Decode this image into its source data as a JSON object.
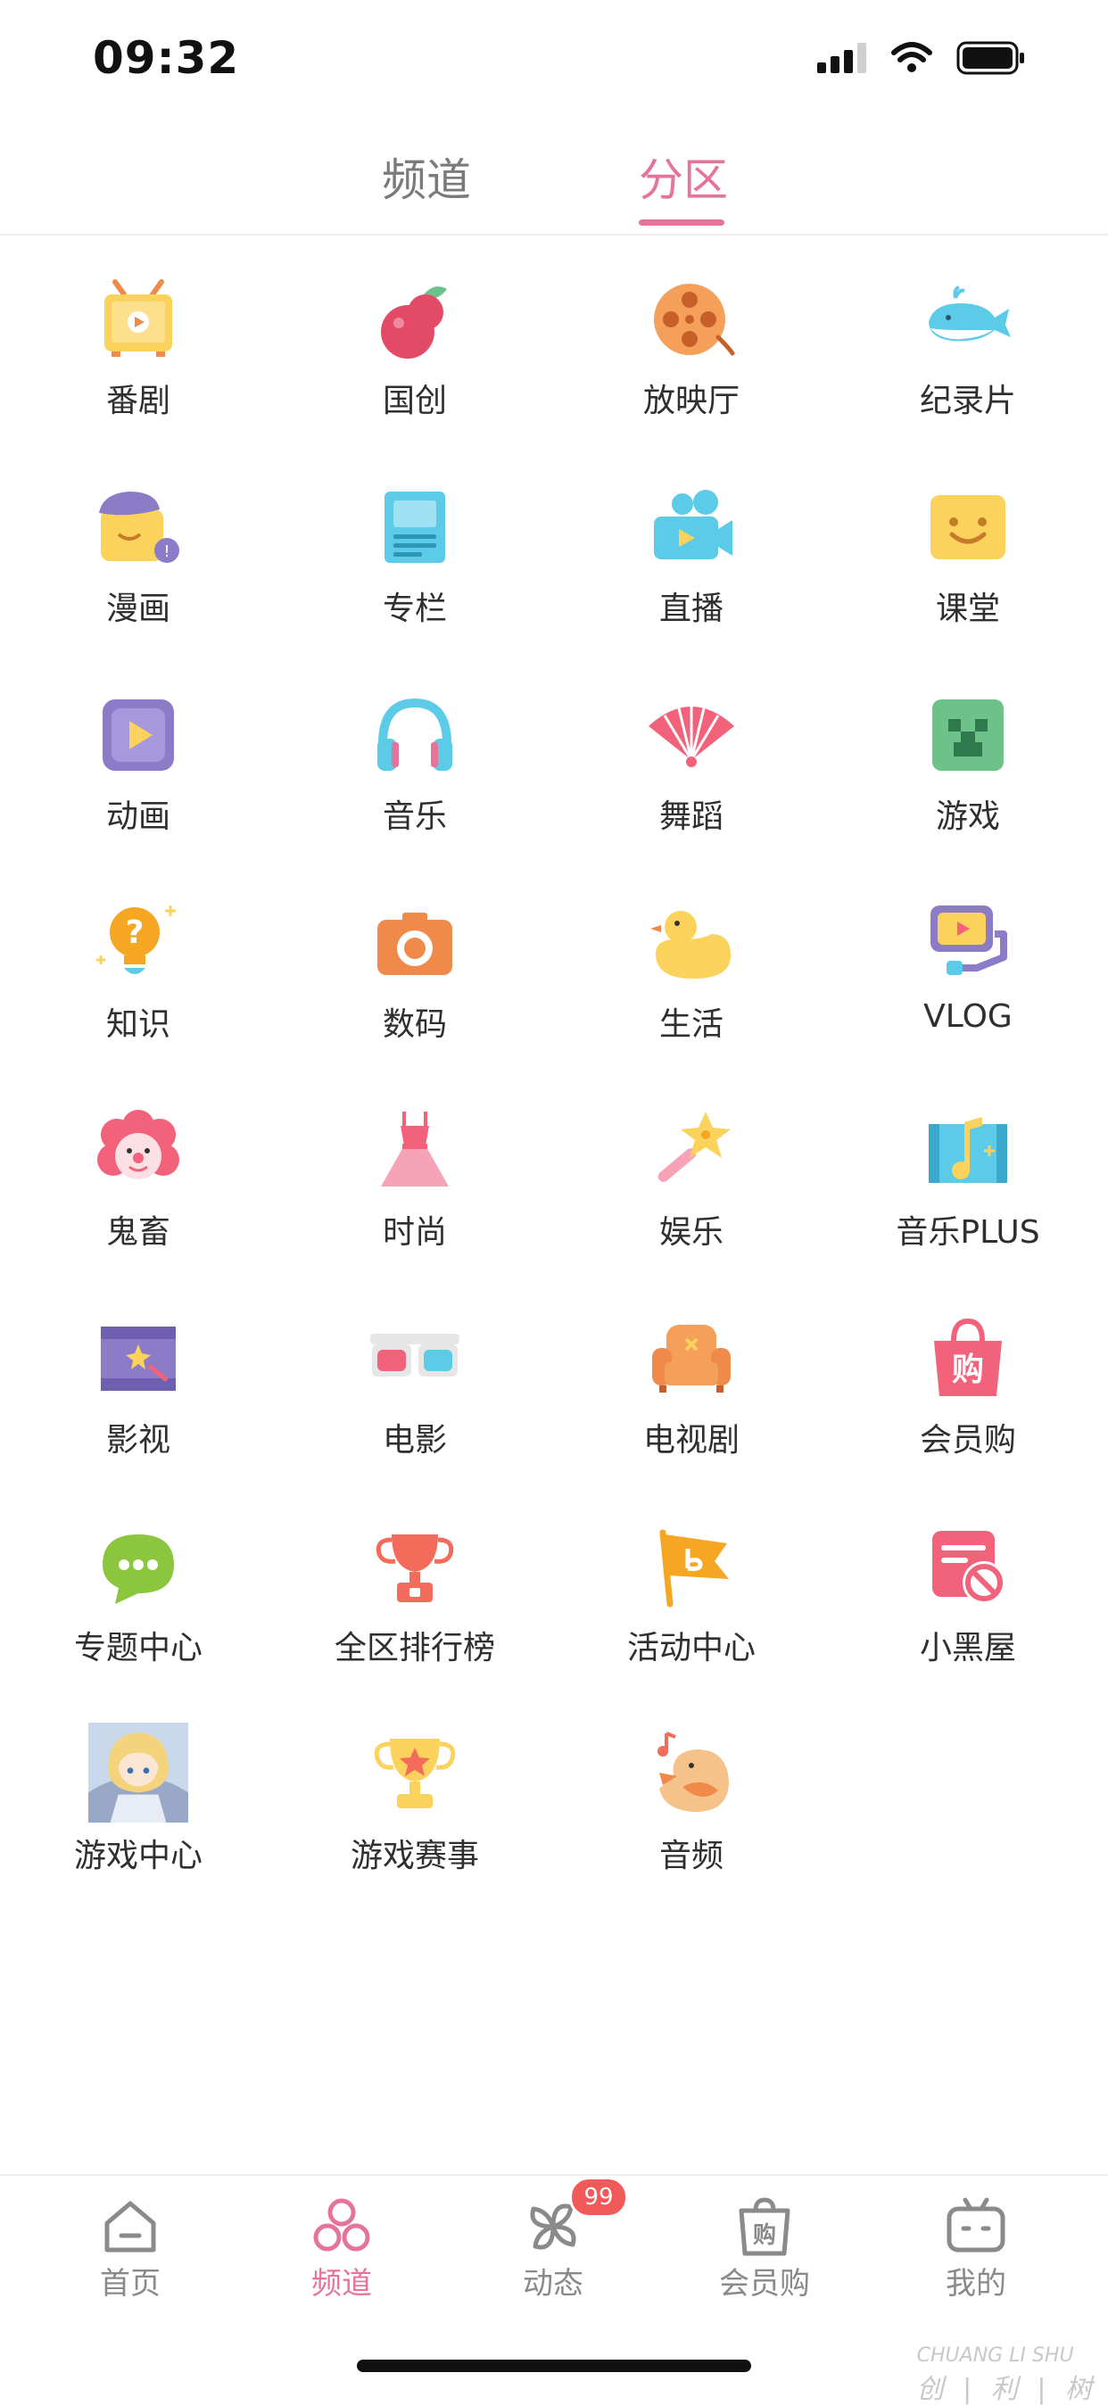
{
  "status_bar": {
    "time": "09:32"
  },
  "top_tabs": {
    "channel": "频道",
    "zone": "分区"
  },
  "grid": [
    [
      {
        "label": "番剧",
        "icon": "tv-icon"
      },
      {
        "label": "国创",
        "icon": "fruit-icon"
      },
      {
        "label": "放映厅",
        "icon": "film-reel-icon"
      },
      {
        "label": "纪录片",
        "icon": "whale-icon"
      }
    ],
    [
      {
        "label": "漫画",
        "icon": "comic-icon"
      },
      {
        "label": "专栏",
        "icon": "article-icon"
      },
      {
        "label": "直播",
        "icon": "camera-icon"
      },
      {
        "label": "课堂",
        "icon": "classroom-icon"
      }
    ],
    [
      {
        "label": "动画",
        "icon": "animation-icon"
      },
      {
        "label": "音乐",
        "icon": "headphones-icon"
      },
      {
        "label": "舞蹈",
        "icon": "fan-icon"
      },
      {
        "label": "游戏",
        "icon": "game-icon"
      }
    ],
    [
      {
        "label": "知识",
        "icon": "lightbulb-icon"
      },
      {
        "label": "数码",
        "icon": "photo-camera-icon"
      },
      {
        "label": "生活",
        "icon": "duck-icon"
      },
      {
        "label": "VLOG",
        "icon": "vlog-icon"
      }
    ],
    [
      {
        "label": "鬼畜",
        "icon": "clown-icon"
      },
      {
        "label": "时尚",
        "icon": "dress-icon"
      },
      {
        "label": "娱乐",
        "icon": "star-wand-icon"
      },
      {
        "label": "音乐PLUS",
        "icon": "music-note-icon"
      }
    ],
    [
      {
        "label": "影视",
        "icon": "film-strip-icon"
      },
      {
        "label": "电影",
        "icon": "3d-glasses-icon"
      },
      {
        "label": "电视剧",
        "icon": "sofa-icon"
      },
      {
        "label": "会员购",
        "icon": "shopping-bag-icon"
      }
    ],
    [
      {
        "label": "专题中心",
        "icon": "chat-bubble-icon"
      },
      {
        "label": "全区排行榜",
        "icon": "trophy-icon"
      },
      {
        "label": "活动中心",
        "icon": "flag-icon"
      },
      {
        "label": "小黑屋",
        "icon": "blocked-card-icon"
      }
    ],
    [
      {
        "label": "游戏中心",
        "icon": "game-center-avatar-icon"
      },
      {
        "label": "游戏赛事",
        "icon": "star-trophy-icon"
      },
      {
        "label": "音频",
        "icon": "bird-icon"
      }
    ]
  ],
  "bottom_nav": [
    {
      "label": "首页",
      "icon": "home-icon"
    },
    {
      "label": "频道",
      "icon": "channel-icon"
    },
    {
      "label": "动态",
      "icon": "pinwheel-icon",
      "badge": "99"
    },
    {
      "label": "会员购",
      "icon": "bag-icon"
    },
    {
      "label": "我的",
      "icon": "tv-face-icon"
    }
  ],
  "watermark": {
    "en": "CHUANG LI SHU",
    "zh": "创 | 利 | 树"
  },
  "colors": {
    "accent": "#e5739a",
    "badge": "#f25a5a"
  }
}
